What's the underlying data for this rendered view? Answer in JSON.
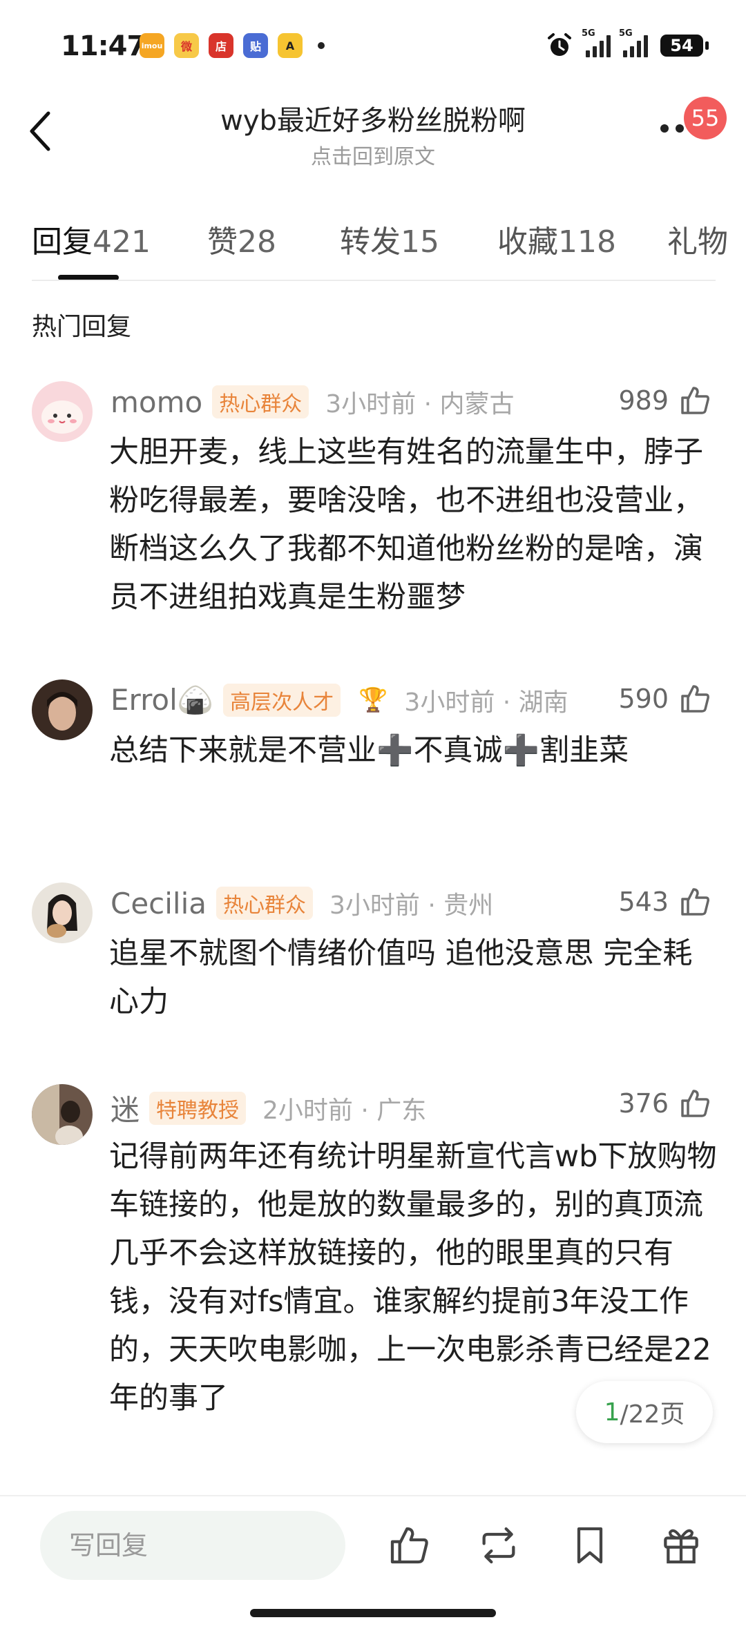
{
  "status_bar": {
    "time": "11:47",
    "app_icons": [
      {
        "name": "imou-app-icon",
        "label": "imou",
        "color": "#f5a623"
      },
      {
        "name": "weibo-app-icon",
        "label": "微",
        "color": "#f7c948"
      },
      {
        "name": "store-app-icon",
        "label": "店",
        "color": "#d9342b"
      },
      {
        "name": "tieba-app-icon",
        "label": "贴",
        "color": "#4a6cd4"
      },
      {
        "name": "meituan-app-icon",
        "label": "A",
        "color": "#f6c431"
      }
    ],
    "net1": "5G",
    "net2": "5G",
    "battery": "54"
  },
  "header": {
    "title": "wyb最近好多粉丝脱粉啊",
    "subtitle": "点击回到原文",
    "notification_count": "55"
  },
  "tabs": [
    {
      "name": "回复",
      "count": "421",
      "active": true
    },
    {
      "name": "赞",
      "count": "28"
    },
    {
      "name": "转发",
      "count": "15"
    },
    {
      "name": "收藏",
      "count": "118"
    },
    {
      "name": "礼物",
      "count": ""
    }
  ],
  "section_title": "热门回复",
  "comments": [
    {
      "username": "momo",
      "badge": "热心群众",
      "meta": "3小时前 · 内蒙古",
      "likes": "989",
      "text": "大胆开麦，线上这些有姓名的流量生中，脖子粉吃得最差，要啥没啥，也不进组也没营业，断档这么久了我都不知道他粉丝粉的是啥，演员不进组拍戏真是生粉噩梦"
    },
    {
      "username": "Errol🍙",
      "badge": "高层次人才",
      "meta": "3小时前 · 湖南",
      "likes": "590",
      "text": "总结下来就是不营业➕不真诚➕割韭菜"
    },
    {
      "username": "Cecilia",
      "badge": "热心群众",
      "meta": "3小时前 · 贵州",
      "likes": "543",
      "text": "追星不就图个情绪价值吗  追他没意思  完全耗心力"
    },
    {
      "username": "迷",
      "badge": "特聘教授",
      "meta": "2小时前 · 广东",
      "likes": "376",
      "text": "记得前两年还有统计明星新宣代言wb下放购物车链接的，他是放的数量最多的，别的真顶流几乎不会这样放链接的，他的眼里真的只有钱，没有对fs情宜。谁家解约提前3年没工作的，天天吹电影咖，上一次电影杀青已经是22年的事了"
    }
  ],
  "pagination": {
    "current": "1",
    "total_text": "/22页"
  },
  "bottom_bar": {
    "reply_placeholder": "写回复"
  }
}
